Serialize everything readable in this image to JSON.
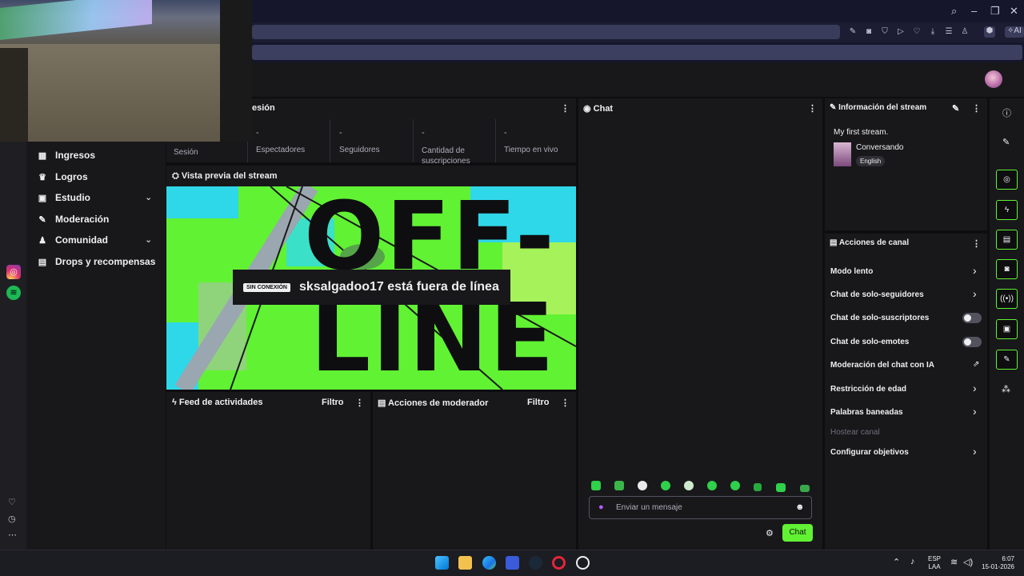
{
  "dashboard": {
    "nav": [
      {
        "label": "Ingresos"
      },
      {
        "label": "Logros"
      },
      {
        "label": "Estudio"
      },
      {
        "label": "Moderación"
      },
      {
        "label": "Comunidad"
      },
      {
        "label": "Drops y recompensas"
      }
    ],
    "session": {
      "title_partial": "esión",
      "label": "Sesión",
      "stats": [
        {
          "value": "-",
          "label": "Espectadores"
        },
        {
          "value": "-",
          "label": "Seguidores"
        },
        {
          "value": "-",
          "label": "Cantidad de suscripciones"
        },
        {
          "value": "-",
          "label": "Tiempo en vivo"
        }
      ]
    },
    "preview": {
      "title": "Vista previa del stream",
      "badge": "SIN CONEXIÓN",
      "message": "sksalgadoo17 está fuera de línea",
      "art_text_top": "OFF-",
      "art_text_bottom": "LINE"
    },
    "feed": {
      "title": "Feed de actividades",
      "filter": "Filtro"
    },
    "mod_actions": {
      "title": "Acciones de moderador",
      "filter": "Filtro"
    },
    "chat": {
      "title": "Chat",
      "placeholder": "Enviar un mensaje",
      "send_label": "Chat"
    },
    "stream_info": {
      "title": "Información del stream",
      "stream_title": "My first stream.",
      "category": "Conversando",
      "language": "English"
    },
    "channel_actions": {
      "title": "Acciones de canal",
      "items": [
        {
          "label": "Modo lento",
          "control": "arrow"
        },
        {
          "label": "Chat de solo-seguidores",
          "control": "arrow"
        },
        {
          "label": "Chat de solo-suscriptores",
          "control": "toggle"
        },
        {
          "label": "Chat de solo-emotes",
          "control": "toggle"
        },
        {
          "label": "Moderación del chat con IA",
          "control": "external"
        },
        {
          "label": "Restricción de edad",
          "control": "arrow"
        },
        {
          "label": "Palabras baneadas",
          "control": "arrow"
        },
        {
          "label": "Hostear canal",
          "control": "disabled"
        },
        {
          "label": "Configurar objetivos",
          "control": "arrow"
        }
      ]
    }
  },
  "browser": {
    "ai_label": "AI"
  },
  "taskbar": {
    "lang_top": "ESP",
    "lang_bottom": "LAA",
    "time": "6:07",
    "date": "15-01-2026"
  },
  "colors": {
    "accent": "#61f233",
    "bg": "#0e0e10",
    "panel": "#18181b"
  }
}
